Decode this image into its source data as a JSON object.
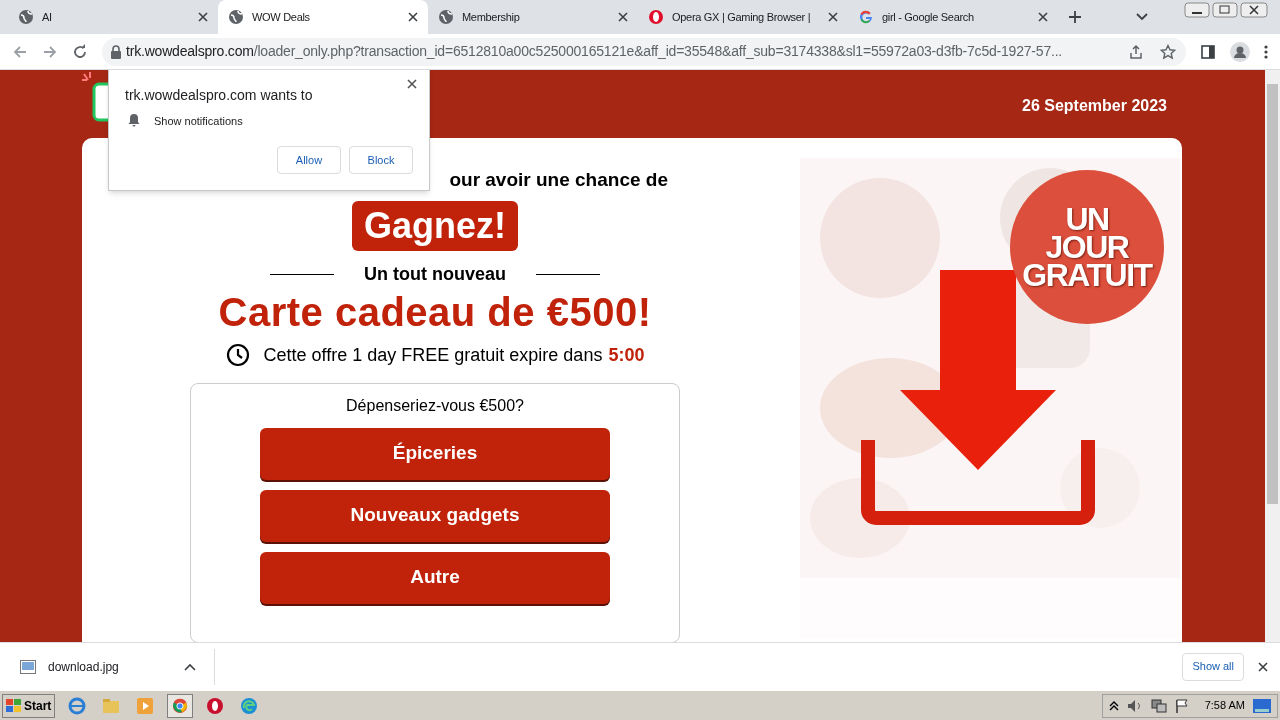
{
  "tabs": [
    {
      "title": "AI",
      "kind": "globe",
      "selected": false
    },
    {
      "title": "WOW Deals",
      "kind": "globe",
      "selected": true
    },
    {
      "title": "Membership",
      "kind": "globe",
      "selected": false
    },
    {
      "title": "Opera GX | Gaming Browser |",
      "kind": "opera",
      "selected": false
    },
    {
      "title": "girl - Google Search",
      "kind": "google",
      "selected": false
    }
  ],
  "address": {
    "domain": "trk.wowdealspro.com",
    "path": "/loader_only.php?transaction_id=6512810a00c525000165121e&aff_id=35548&aff_sub=3174338&sl1=55972a03-d3fb-7c5d-1927-57..."
  },
  "notification": {
    "origin": "trk.wowdealspro.com wants to",
    "permission": "Show notifications",
    "buttons": [
      "Allow",
      "Block"
    ]
  },
  "page": {
    "date": "26 September 2023",
    "lead": "our avoir une chance de",
    "badge": "Gagnez!",
    "subheading": "Un tout nouveau",
    "title": "Carte cadeau de €500!",
    "offer": "Cette offre 1 day FREE gratuit expire dans",
    "timer": "5:00",
    "question": "Dépenseriez-vous €500?",
    "options": [
      "Épiceries",
      "Nouveaux gadgets",
      "Autre"
    ],
    "promo": [
      "UN",
      "JOUR",
      "GRATUIT"
    ]
  },
  "download_bar": {
    "file": "download.jpg",
    "show_all": "Show all"
  },
  "taskbar": {
    "start": "Start",
    "time": "7:58 AM"
  }
}
